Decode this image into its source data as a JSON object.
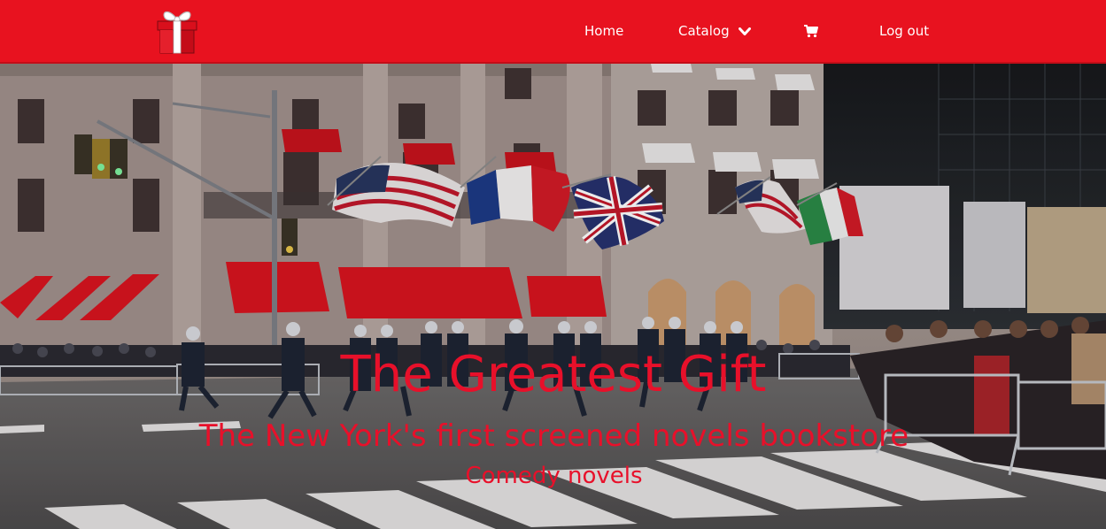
{
  "nav": {
    "logo_icon": "gift-box-icon",
    "home_label": "Home",
    "catalog_label": "Catalog",
    "catalog_icon": "chevron-down-icon",
    "cart_icon": "shopping-cart-icon",
    "logout_label": "Log out"
  },
  "hero": {
    "image": "new-york-street-parade-photo",
    "title": "The Greatest Gift",
    "subtitle": "The New York's first screened novels bookstore",
    "tagline": "Comedy novels"
  },
  "colors": {
    "brand_red": "#e8121f",
    "hero_text": "#e8102a",
    "nav_text": "#ffffff"
  }
}
